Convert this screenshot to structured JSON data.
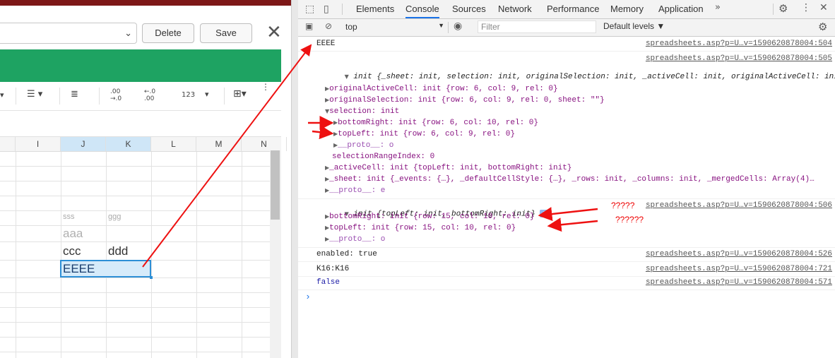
{
  "app": {
    "delete_label": "Delete",
    "save_label": "Save",
    "close_glyph": "✕",
    "accent": "#1ea362"
  },
  "toolbar": {
    "decimal_increase": ".00\n→.0",
    "decimal_decrease": "←.0\n.00",
    "number_format": "123"
  },
  "sheet": {
    "columns": [
      "I",
      "J",
      "K",
      "L",
      "M",
      "N"
    ],
    "selected_column": "J",
    "cells": {
      "j_small": "sss",
      "k_small": "ggg",
      "j_aaa": "aaa",
      "j_ccc": "ccc",
      "k_ddd": "ddd",
      "j_eeee": "EEEE"
    }
  },
  "devtools": {
    "tabs": [
      "Elements",
      "Console",
      "Sources",
      "Network",
      "Performance",
      "Memory",
      "Application"
    ],
    "active_tab": "Console",
    "context": "top",
    "filter_placeholder": "Filter",
    "levels": "Default levels ▼",
    "console": {
      "l1_text": "EEEE",
      "l1_src": "spreadsheets.asp?p=U…v=1590620878004:504",
      "l2_src": "spreadsheets.asp?p=U…v=1590620878004:505",
      "l2_head": "init {_sheet: init, selection: init, originalSelection: init, _activeCell: init, originalActiveCell: init}",
      "l2_p1": "originalActiveCell: init {row: 6, col: 9, rel: 0}",
      "l2_p2": "originalSelection: init {row: 6, col: 9, rel: 0, sheet: \"\"}",
      "l2_p3": "selection: init",
      "l2_p4": "bottomRight: init {row: 6, col: 10, rel: 0}",
      "l2_p5": "topLeft: init {row: 6, col: 9, rel: 0}",
      "l2_p6": "__proto__: o",
      "l2_p7": "selectionRangeIndex: 0",
      "l2_p8": "_activeCell: init {topLeft: init, bottomRight: init}",
      "l2_p9": "_sheet: init {_events: {…}, _defaultCellStyle: {…}, _rows: init, _columns: init, _mergedCells: Array(4)…",
      "l2_p10": "__proto__: e",
      "l3_src": "spreadsheets.asp?p=U…v=1590620878004:506",
      "l3_head": "init {topLeft: init, bottomRight: init}",
      "l3_p1": "bottomRight: init {row: 15, col: 10, rel: 0}",
      "l3_p2": "topLeft: init {row: 15, col: 10, rel: 0}",
      "l3_p3": "__proto__: o",
      "l4_text": "enabled: true",
      "l4_src": "spreadsheets.asp?p=U…v=1590620878004:526",
      "l5_text": "K16:K16",
      "l5_src": "spreadsheets.asp?p=U…v=1590620878004:721",
      "l6_text": "false",
      "l6_src": "spreadsheets.asp?p=U…v=1590620878004:571",
      "prompt": "›"
    },
    "annotations": {
      "q1": "?????",
      "q2": "??????"
    }
  }
}
